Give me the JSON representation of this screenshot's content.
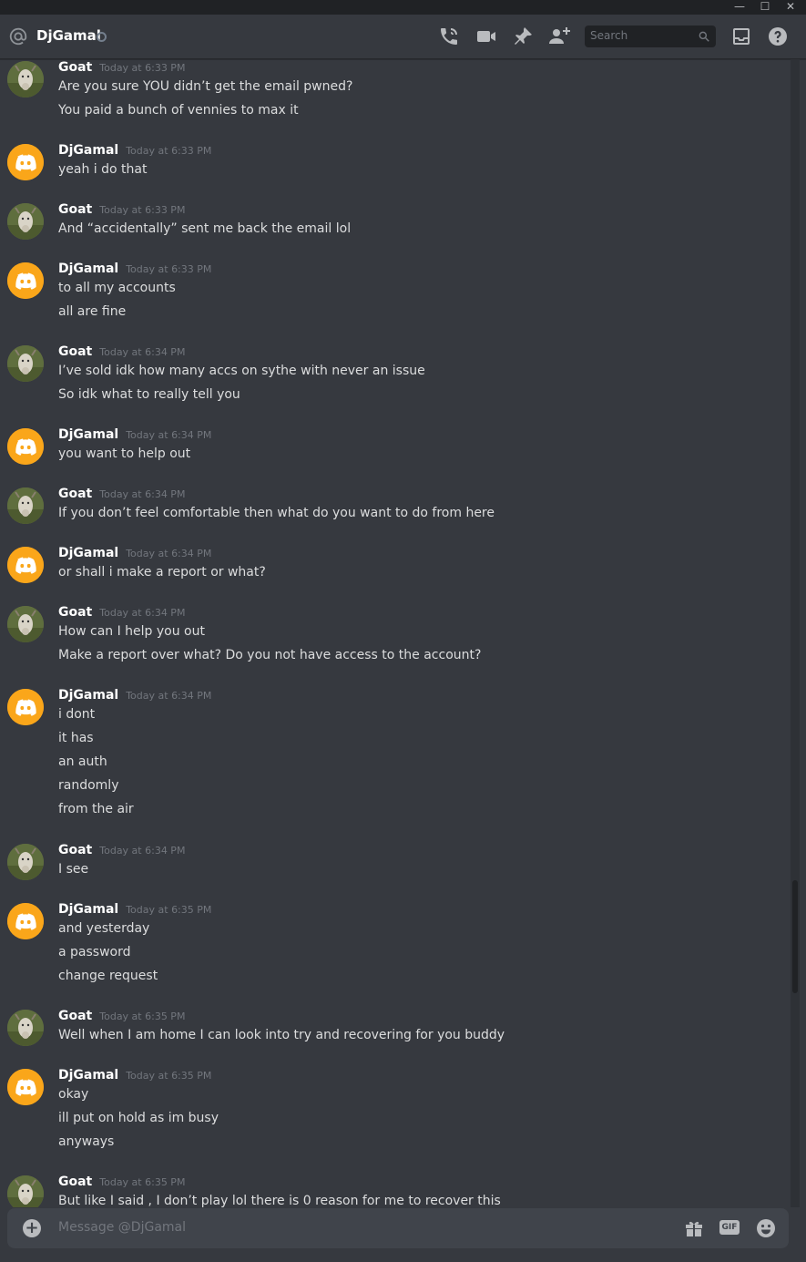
{
  "window": {
    "minimize": "—",
    "maximize": "☐",
    "close": "✕"
  },
  "header": {
    "channel_name": "DjGamal",
    "search_placeholder": "Search"
  },
  "icons": [
    "at-icon",
    "phone-icon",
    "video-icon",
    "pin-icon",
    "add-friend-icon",
    "search-icon",
    "inbox-icon",
    "help-icon",
    "attach-plus-icon",
    "gift-icon",
    "gif-icon",
    "emoji-icon"
  ],
  "messages": [
    {
      "author": "Goat",
      "timestamp": "Today at 6:33 PM",
      "lines": [
        "Are you sure YOU didn’t get the email pwned?",
        "You paid a bunch of vennies to max it"
      ]
    },
    {
      "author": "DjGamal",
      "timestamp": "Today at 6:33 PM",
      "lines": [
        "yeah i do that"
      ]
    },
    {
      "author": "Goat",
      "timestamp": "Today at 6:33 PM",
      "lines": [
        "And “accidentally” sent me back the email lol"
      ]
    },
    {
      "author": "DjGamal",
      "timestamp": "Today at 6:33 PM",
      "lines": [
        "to all my accounts",
        "all are fine"
      ]
    },
    {
      "author": "Goat",
      "timestamp": "Today at 6:34 PM",
      "lines": [
        "I’ve sold idk how many accs on sythe with never an issue",
        "So idk what to really tell you"
      ]
    },
    {
      "author": "DjGamal",
      "timestamp": "Today at 6:34 PM",
      "lines": [
        "you want to help out"
      ]
    },
    {
      "author": "Goat",
      "timestamp": "Today at 6:34 PM",
      "lines": [
        "If you don’t feel comfortable then what do you want to do from here"
      ]
    },
    {
      "author": "DjGamal",
      "timestamp": "Today at 6:34 PM",
      "lines": [
        "or shall i make a report or what?"
      ]
    },
    {
      "author": "Goat",
      "timestamp": "Today at 6:34 PM",
      "lines": [
        "How can I help you out",
        "Make a report over what? Do you not have access to the account?"
      ]
    },
    {
      "author": "DjGamal",
      "timestamp": "Today at 6:34 PM",
      "lines": [
        "i dont",
        "it has",
        "an auth",
        "randomly",
        "from the air"
      ]
    },
    {
      "author": "Goat",
      "timestamp": "Today at 6:34 PM",
      "lines": [
        "I see"
      ]
    },
    {
      "author": "DjGamal",
      "timestamp": "Today at 6:35 PM",
      "lines": [
        "and yesterday",
        "a password",
        "change request"
      ]
    },
    {
      "author": "Goat",
      "timestamp": "Today at 6:35 PM",
      "lines": [
        "Well when I am home I can look into try and recovering for you buddy"
      ]
    },
    {
      "author": "DjGamal",
      "timestamp": "Today at 6:35 PM",
      "lines": [
        "okay",
        "ill put on hold as im busy",
        "anyways"
      ]
    },
    {
      "author": "Goat",
      "timestamp": "Today at 6:35 PM",
      "lines": [
        "But like I said , I don’t play lol there is 0 reason for me to recover this"
      ]
    }
  ],
  "composer": {
    "placeholder": "Message @DjGamal",
    "gif_label": "GIF",
    "plus_label": "+"
  },
  "colors": {
    "background": "#36393f",
    "titlebar": "#202225",
    "composer": "#40444b",
    "dj_avatar": "#faa61a"
  }
}
